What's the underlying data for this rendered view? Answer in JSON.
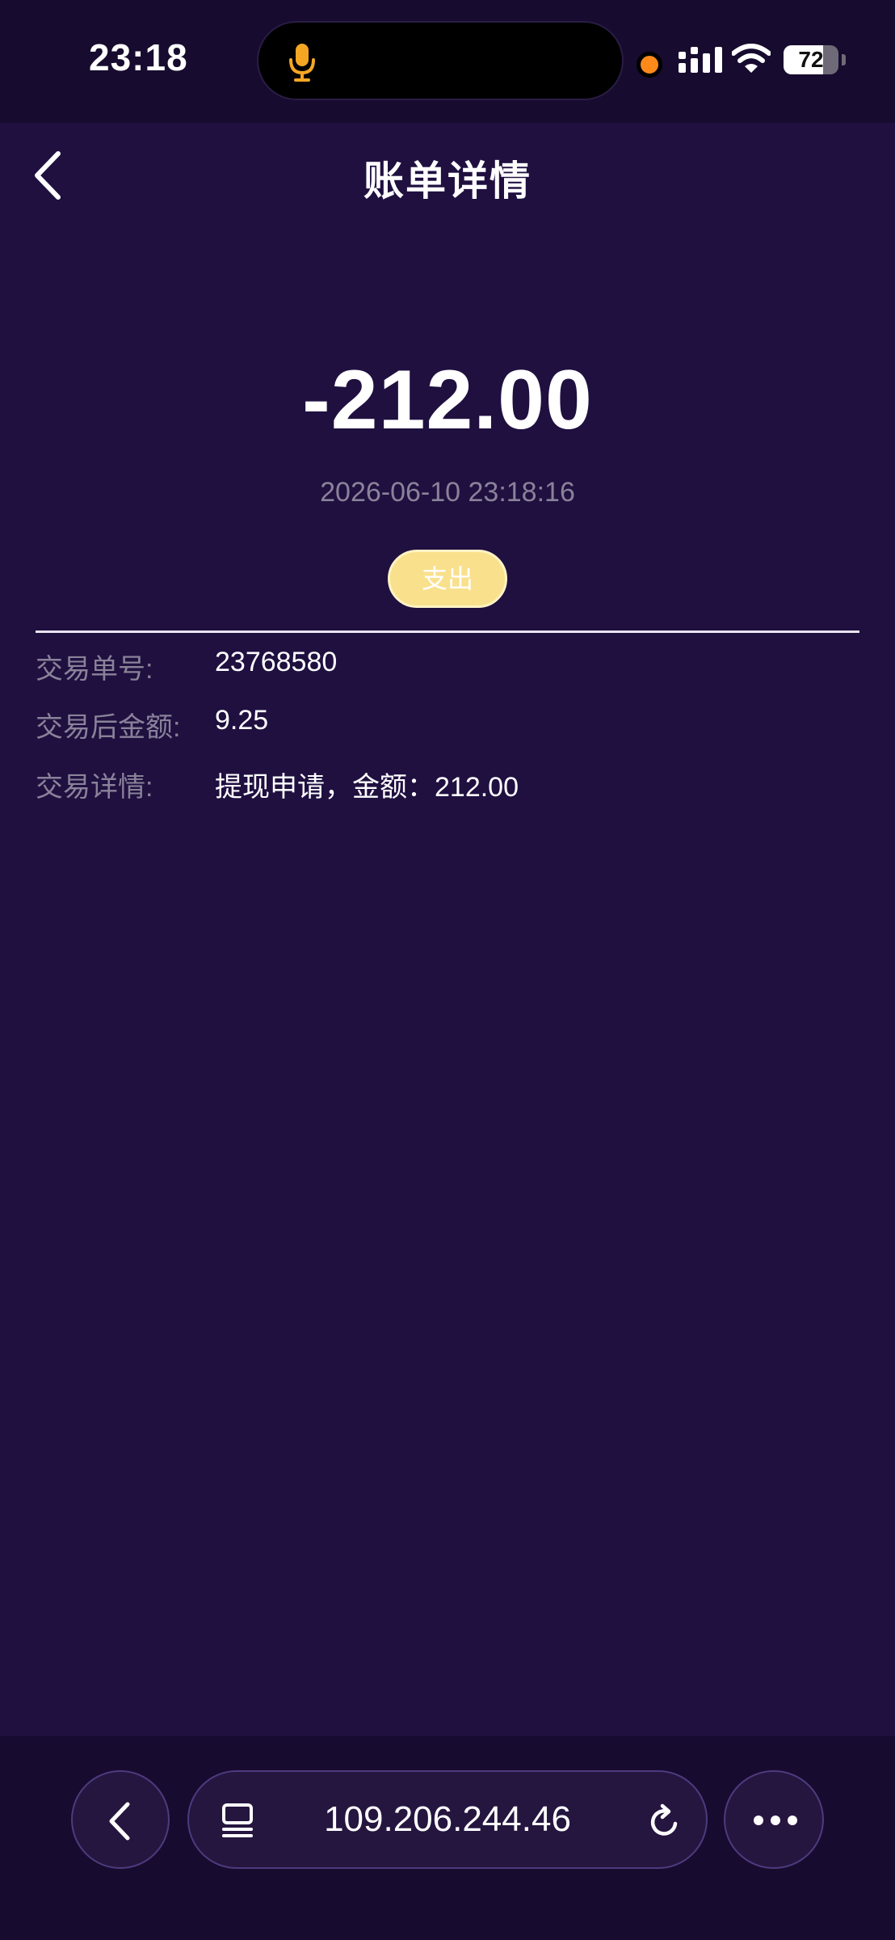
{
  "status_bar": {
    "time": "23:18",
    "battery_level": "72",
    "battery_fraction": 0.72
  },
  "header": {
    "title": "账单详情"
  },
  "transaction": {
    "amount": "-212.00",
    "datetime": "2026-06-10 23:18:16",
    "type": "支出"
  },
  "details": [
    {
      "label": "交易单号:",
      "value": "23768580"
    },
    {
      "label": "交易后金额:",
      "value": "9.25"
    },
    {
      "label": "交易详情:",
      "value": "提现申请，金额：212.00"
    }
  ],
  "browser": {
    "url": "109.206.244.46"
  },
  "icons": {
    "back": "chevron-left-icon",
    "mic": "microphone-icon",
    "signal": "cellular-signal-icon",
    "wifi": "wifi-icon",
    "tabs": "tabs-icon",
    "reload": "reload-icon",
    "more": "more-dots-icon"
  },
  "colors": {
    "background": "#1f1040",
    "bar_background": "#170b2f",
    "badge": "#f9e08c",
    "muted_text": "#8a8299",
    "mic_accent": "#f5a623",
    "recording_dot": "#ff8a1a"
  }
}
